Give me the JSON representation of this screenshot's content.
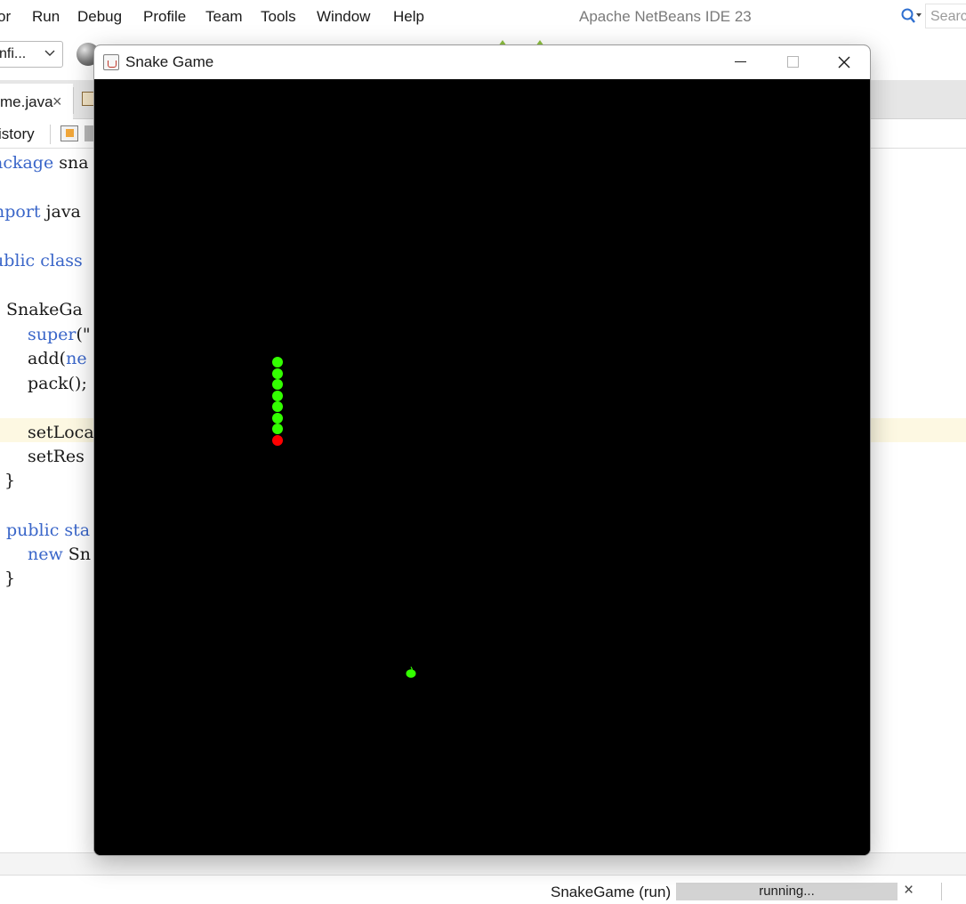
{
  "ide": {
    "title": "Apache NetBeans IDE 23",
    "menu": [
      "or",
      "Run",
      "Debug",
      "Profile",
      "Team",
      "Tools",
      "Window",
      "Help"
    ],
    "search_placeholder": "Searc",
    "config_value": "nfi...",
    "editor_tab": "me.java",
    "editor_tab_close": "×",
    "history_label": "istory",
    "code": [
      {
        "kw": "ackage",
        "rest": " sna"
      },
      {
        "kw": "nport",
        "rest": " java"
      },
      {
        "kw": "ublic class",
        "rest": ""
      },
      {
        "kw": "",
        "rest": "SnakeGa"
      },
      {
        "kw": "super",
        "rest": "(\""
      },
      {
        "kw": "",
        "rest": "add(",
        "kw2": "ne"
      },
      {
        "kw": "",
        "rest": "pack();"
      },
      {
        "kw": "",
        "rest": "setLoca"
      },
      {
        "kw": "",
        "rest": "setRes"
      },
      {
        "kw": "",
        "rest": "}"
      },
      {
        "kw": "public sta",
        "rest": ""
      },
      {
        "kw": "new",
        "rest": " Sn"
      },
      {
        "kw": "",
        "rest": "}"
      }
    ],
    "status": {
      "task": "SnakeGame (run)",
      "progress_text": "running...",
      "close": "×"
    }
  },
  "game_window": {
    "title": "Snake Game",
    "buttons": [
      "minimize",
      "maximize",
      "close"
    ],
    "colors": {
      "board": "#000000",
      "snake_body": "#33ff00",
      "snake_head": "#ff0000",
      "apple": "#33ff00"
    },
    "snake_segments": 8
  }
}
